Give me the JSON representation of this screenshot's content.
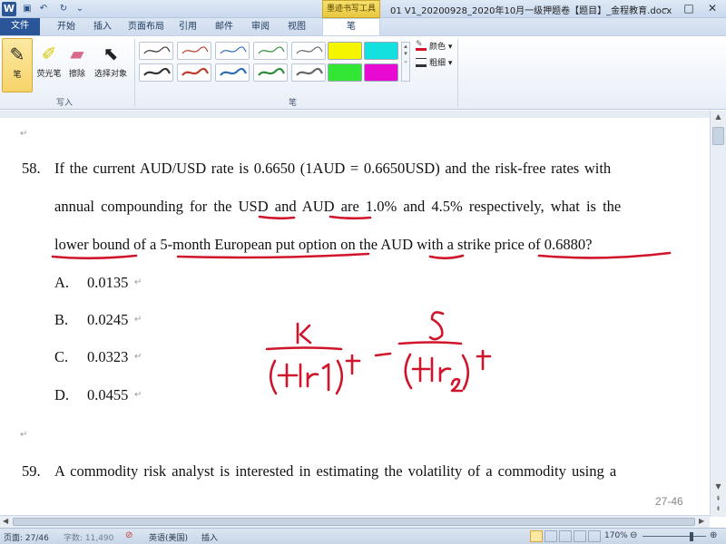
{
  "window": {
    "title": "01 V1_20200928_2020年10月一级押题卷【题目】_金程教育.docx",
    "context_group": "墨迹书写工具",
    "min_symbol": "–",
    "max_symbol": "□",
    "close_symbol": "✕"
  },
  "tabs": [
    "文件",
    "开始",
    "插入",
    "页面布局",
    "引用",
    "邮件",
    "审阅",
    "视图",
    "笔"
  ],
  "ribbon": {
    "pen_label": "笔",
    "highlighter_label": "荧光笔",
    "eraser_label": "擦除",
    "select_label": "选择对象",
    "group_write": "写入",
    "group_pens": "笔",
    "color_label": "颜色",
    "thickness_label": "粗细"
  },
  "colors": {
    "ink_red": "#d0142b",
    "pen_styles": [
      "#333333",
      "#c0392b",
      "#2f6db5",
      "#2e8b3a",
      "#666666",
      "#333333",
      "#c0392b",
      "#2f6db5",
      "#2e8b3a",
      "#666666"
    ],
    "highlighters": [
      "#f5f500",
      "#14e0e0",
      "#33e633",
      "#e60ad2"
    ]
  },
  "document": {
    "q58_number": "58.",
    "q58_line1": "If the current AUD/USD rate is 0.6650 (1AUD = 0.6650USD) and the risk-free rates with",
    "q58_line2": "annual compounding for the USD and AUD are 1.0% and 4.5% respectively, what is the",
    "q58_line3": "lower bound of a 5-month European put option on the AUD with a strike price of 0.6880?",
    "options": [
      {
        "letter": "A.",
        "value": "0.0135"
      },
      {
        "letter": "B.",
        "value": "0.0245"
      },
      {
        "letter": "C.",
        "value": "0.0323"
      },
      {
        "letter": "D.",
        "value": "0.0455"
      }
    ],
    "q59_number": "59.",
    "q59_line1": "A commodity risk analyst is interested in estimating the volatility of a commodity using a",
    "page_number": "27-46",
    "para_mark": "↵"
  },
  "status": {
    "page": "页面: 27/46",
    "words": "字数: 11,490",
    "language": "英语(美国)",
    "mode": "插入",
    "zoom": "170%"
  }
}
